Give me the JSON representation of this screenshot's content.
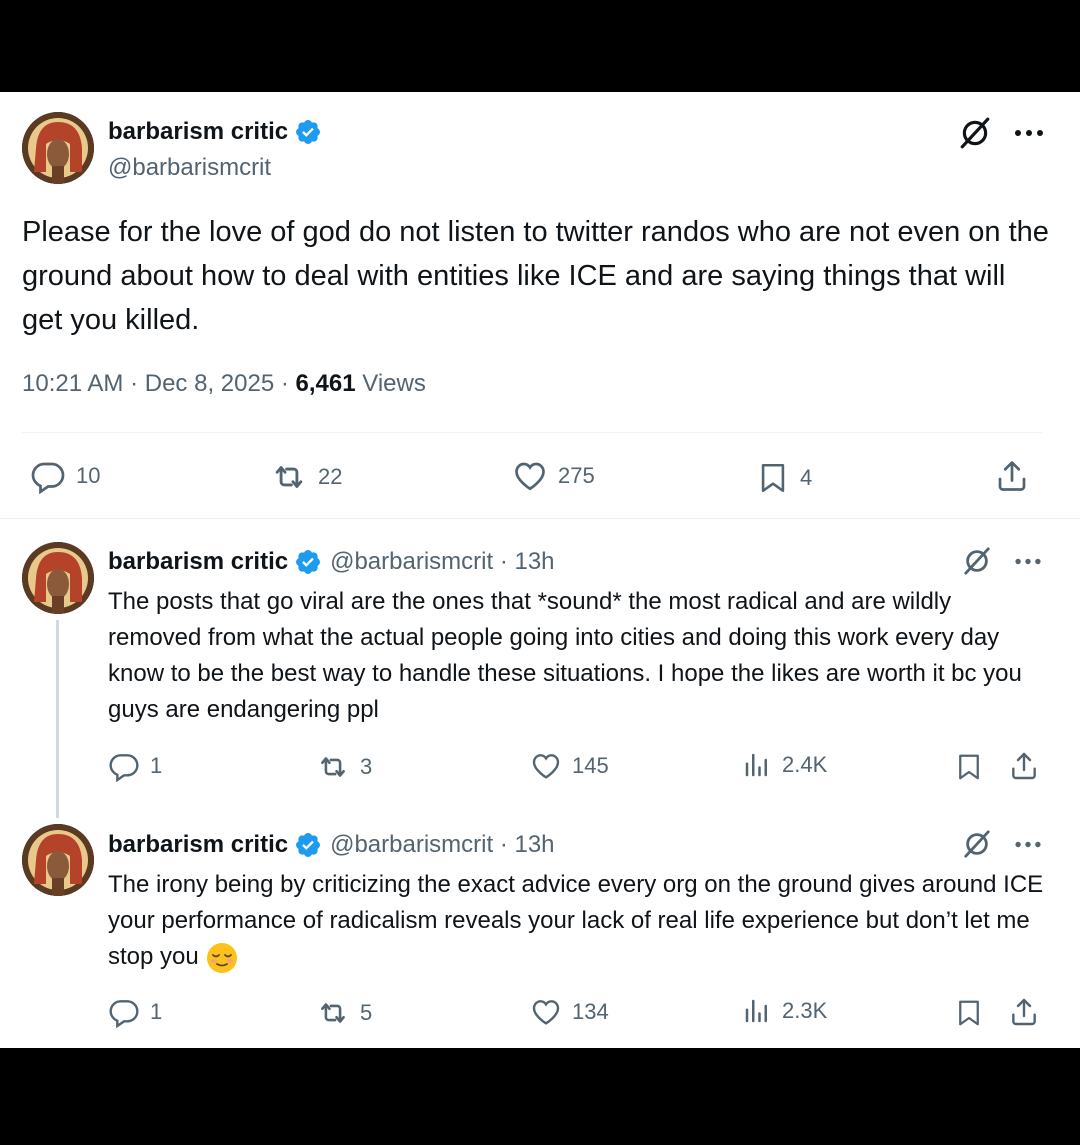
{
  "main_tweet": {
    "display_name": "barbarism critic",
    "handle": "@barbarismcrit",
    "text": "Please for the love of god do not listen to twitter randos who are not even on the ground about how to deal with entities like ICE and are saying things that will get you killed.",
    "time": "10:21 AM",
    "sep": "·",
    "date": "Dec 8, 2025",
    "views_count": "6,461",
    "views_label": "Views",
    "replies": "10",
    "reposts": "22",
    "likes": "275",
    "bookmarks": "4"
  },
  "replies": [
    {
      "display_name": "barbarism critic",
      "handle_time": "@barbarismcrit · 13h",
      "text": "The posts that go viral are the ones that *sound* the most radical and are wildly removed from what the actual people going into cities and doing this work every day know to be the best way to handle these situations. I hope the likes are worth it bc you guys are endangering ppl",
      "replies": "1",
      "reposts": "3",
      "likes": "145",
      "views": "2.4K"
    },
    {
      "display_name": "barbarism critic",
      "handle_time": "@barbarismcrit · 13h",
      "text": "The irony being by criticizing the exact advice every org on the ground gives around ICE your performance of radicalism reveals your lack of real life experience but don’t let me stop you",
      "replies": "1",
      "reposts": "5",
      "likes": "134",
      "views": "2.3K"
    }
  ],
  "colors": {
    "verified": "#1d9bf0",
    "muted": "#536471",
    "text": "#0f1419",
    "background": "#ffffff"
  },
  "icons": [
    "verified-badge-icon",
    "grok-icon",
    "more-icon",
    "reply-icon",
    "repost-icon",
    "like-icon",
    "bookmark-icon",
    "share-icon",
    "views-icon",
    "relieved-face-emoji"
  ]
}
